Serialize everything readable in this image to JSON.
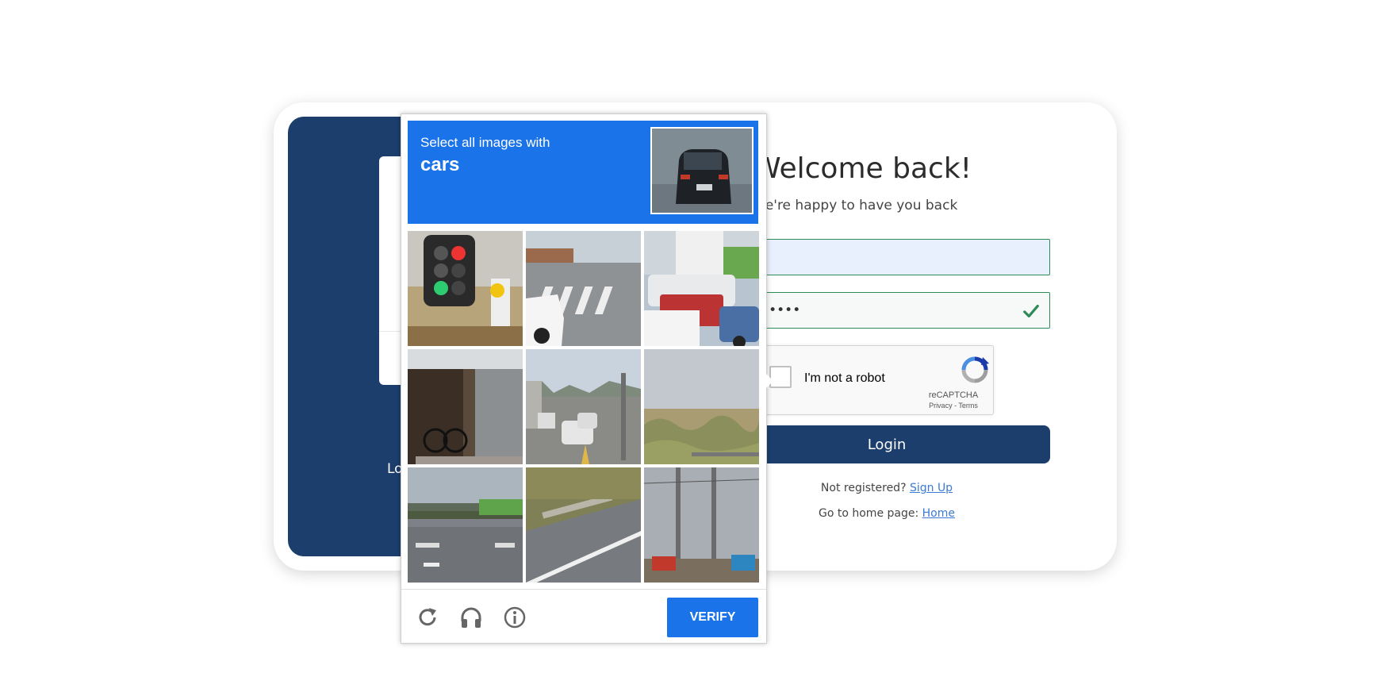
{
  "login": {
    "welcome_title": "Welcome back!",
    "welcome_subtitle": "We're happy to have you back",
    "left_panel_text": "Lo",
    "username_value": "",
    "password_value": "••••••••",
    "login_button": "Login",
    "not_registered": "Not registered?",
    "signup_link": "Sign Up",
    "home_prefix": "Go to home page:",
    "home_link": "Home"
  },
  "recaptcha": {
    "checkbox_label": "I'm not a robot",
    "brand": "reCAPTCHA",
    "privacy": "Privacy",
    "separator": " - ",
    "terms": "Terms"
  },
  "challenge": {
    "instruction": "Select all images with",
    "target": "cars",
    "verify_button": "VERIFY",
    "header_color": "#1a73e8",
    "tiles": [
      {
        "id": "tile-1",
        "subject": "traffic light and shell sign"
      },
      {
        "id": "tile-2",
        "subject": "crosswalk with white car"
      },
      {
        "id": "tile-3",
        "subject": "parked cars and vans"
      },
      {
        "id": "tile-4",
        "subject": "garage with bicycles"
      },
      {
        "id": "tile-5",
        "subject": "street with cars"
      },
      {
        "id": "tile-6",
        "subject": "dune grass"
      },
      {
        "id": "tile-7",
        "subject": "highway overpass"
      },
      {
        "id": "tile-8",
        "subject": "road with guardrail"
      },
      {
        "id": "tile-9",
        "subject": "utility poles"
      }
    ]
  },
  "icons": {
    "reload": "reload-icon",
    "audio": "headphones-icon",
    "info": "info-icon",
    "check": "check-icon"
  },
  "colors": {
    "navy": "#1c3e6d",
    "accent_green": "#2e8b57",
    "link": "#3a7bd5"
  }
}
